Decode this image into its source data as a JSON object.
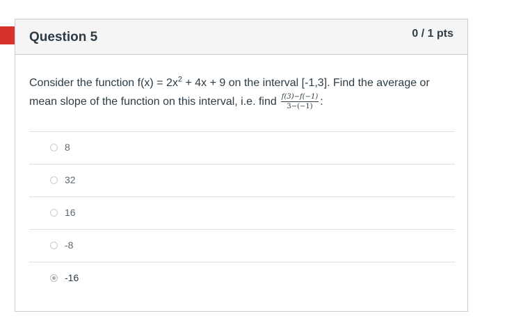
{
  "question": {
    "title": "Question 5",
    "points": "0 / 1 pts",
    "text_line1_pre": "Consider the function f(x) = 2x",
    "text_line1_sup": "2",
    "text_line1_post": " + 4x + 9 on the interval [-1,3].  Find the average or",
    "text_line2": "mean slope of the function on this interval, i.e. find ",
    "fraction_numerator": "f(3)−f(−1)",
    "fraction_denominator": "3−(−1)",
    "fraction_suffix": ":"
  },
  "answers": [
    {
      "label": "8",
      "selected": false
    },
    {
      "label": "32",
      "selected": false
    },
    {
      "label": "16",
      "selected": false
    },
    {
      "label": "-8",
      "selected": false
    },
    {
      "label": "-16",
      "selected": true
    }
  ],
  "colors": {
    "flag": "#d9322b",
    "header_bg": "#f5f5f5",
    "border": "#c7cdd1",
    "text": "#2d3b45"
  },
  "icons": {
    "flag": "incorrect-answer-flag-icon"
  }
}
